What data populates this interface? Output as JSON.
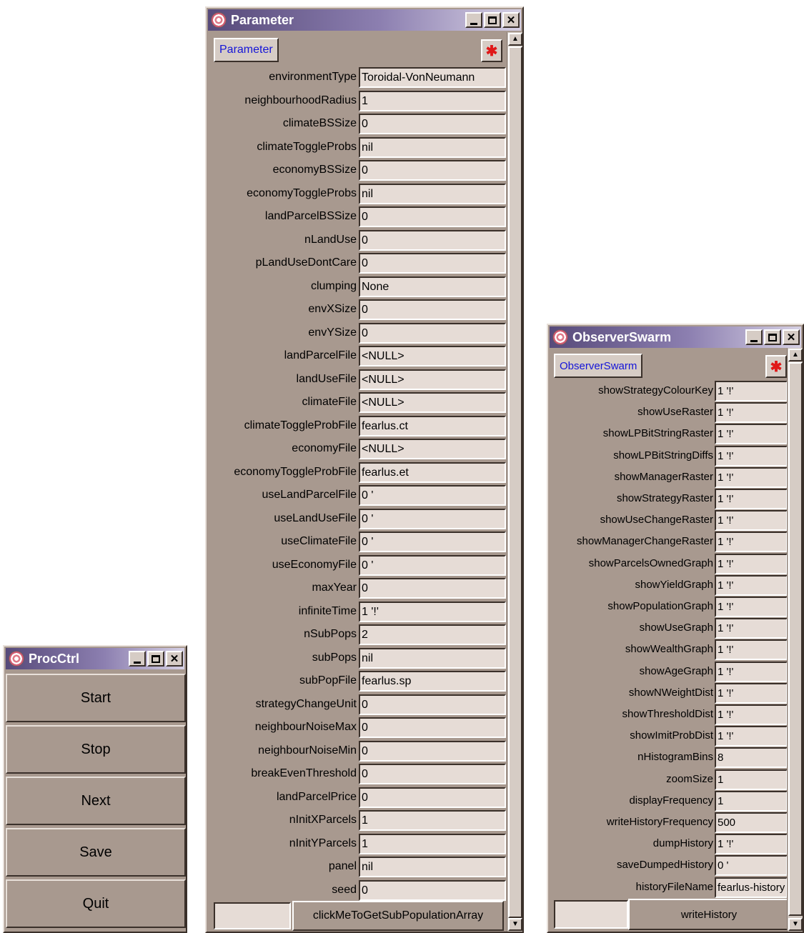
{
  "procctrl": {
    "title": "ProcCtrl",
    "buttons": [
      {
        "label": "Start"
      },
      {
        "label": "Stop"
      },
      {
        "label": "Next"
      },
      {
        "label": "Save"
      },
      {
        "label": "Quit"
      }
    ]
  },
  "parameter": {
    "title": "Parameter",
    "tag_label": "Parameter",
    "fields": [
      {
        "label": "environmentType",
        "value": "Toroidal-VonNeumann"
      },
      {
        "label": "neighbourhoodRadius",
        "value": "1"
      },
      {
        "label": "climateBSSize",
        "value": "0"
      },
      {
        "label": "climateToggleProbs",
        "value": "nil"
      },
      {
        "label": "economyBSSize",
        "value": "0"
      },
      {
        "label": "economyToggleProbs",
        "value": "nil"
      },
      {
        "label": "landParcelBSSize",
        "value": "0"
      },
      {
        "label": "nLandUse",
        "value": "0"
      },
      {
        "label": "pLandUseDontCare",
        "value": "0"
      },
      {
        "label": "clumping",
        "value": "None"
      },
      {
        "label": "envXSize",
        "value": "0"
      },
      {
        "label": "envYSize",
        "value": "0"
      },
      {
        "label": "landParcelFile",
        "value": "<NULL>"
      },
      {
        "label": "landUseFile",
        "value": "<NULL>"
      },
      {
        "label": "climateFile",
        "value": "<NULL>"
      },
      {
        "label": "climateToggleProbFile",
        "value": "fearlus.ct"
      },
      {
        "label": "economyFile",
        "value": "<NULL>"
      },
      {
        "label": "economyToggleProbFile",
        "value": "fearlus.et"
      },
      {
        "label": "useLandParcelFile",
        "value": "0 '"
      },
      {
        "label": "useLandUseFile",
        "value": "0 '"
      },
      {
        "label": "useClimateFile",
        "value": "0 '"
      },
      {
        "label": "useEconomyFile",
        "value": "0 '"
      },
      {
        "label": "maxYear",
        "value": "0"
      },
      {
        "label": "infiniteTime",
        "value": "1 '!'"
      },
      {
        "label": "nSubPops",
        "value": "2"
      },
      {
        "label": "subPops",
        "value": "nil"
      },
      {
        "label": "subPopFile",
        "value": "fearlus.sp"
      },
      {
        "label": "strategyChangeUnit",
        "value": "0"
      },
      {
        "label": "neighbourNoiseMax",
        "value": "0"
      },
      {
        "label": "neighbourNoiseMin",
        "value": "0"
      },
      {
        "label": "breakEvenThreshold",
        "value": "0"
      },
      {
        "label": "landParcelPrice",
        "value": "0"
      },
      {
        "label": "nInitXParcels",
        "value": "1"
      },
      {
        "label": "nInitYParcels",
        "value": "1"
      },
      {
        "label": "panel",
        "value": "nil"
      },
      {
        "label": "seed",
        "value": "0"
      }
    ],
    "action_label": "clickMeToGetSubPopulationArray"
  },
  "observer": {
    "title": "ObserverSwarm",
    "tag_label": "ObserverSwarm",
    "fields": [
      {
        "label": "showStrategyColourKey",
        "value": "1 '!'"
      },
      {
        "label": "showUseRaster",
        "value": "1 '!'"
      },
      {
        "label": "showLPBitStringRaster",
        "value": "1 '!'"
      },
      {
        "label": "showLPBitStringDiffs",
        "value": "1 '!'"
      },
      {
        "label": "showManagerRaster",
        "value": "1 '!'"
      },
      {
        "label": "showStrategyRaster",
        "value": "1 '!'"
      },
      {
        "label": "showUseChangeRaster",
        "value": "1 '!'"
      },
      {
        "label": "showManagerChangeRaster",
        "value": "1 '!'"
      },
      {
        "label": "showParcelsOwnedGraph",
        "value": "1 '!'"
      },
      {
        "label": "showYieldGraph",
        "value": "1 '!'"
      },
      {
        "label": "showPopulationGraph",
        "value": "1 '!'"
      },
      {
        "label": "showUseGraph",
        "value": "1 '!'"
      },
      {
        "label": "showWealthGraph",
        "value": "1 '!'"
      },
      {
        "label": "showAgeGraph",
        "value": "1 '!'"
      },
      {
        "label": "showNWeightDist",
        "value": "1 '!'"
      },
      {
        "label": "showThresholdDist",
        "value": "1 '!'"
      },
      {
        "label": "showImitProbDist",
        "value": "1 '!'"
      },
      {
        "label": "nHistogramBins",
        "value": "8"
      },
      {
        "label": "zoomSize",
        "value": "1"
      },
      {
        "label": "displayFrequency",
        "value": "1"
      },
      {
        "label": "writeHistoryFrequency",
        "value": "500"
      },
      {
        "label": "dumpHistory",
        "value": "1 '!'"
      },
      {
        "label": "saveDumpedHistory",
        "value": "0 '"
      },
      {
        "label": "historyFileName",
        "value": "fearlus-history"
      }
    ],
    "action_label": "writeHistory"
  },
  "icons": {
    "app": "swarm-app-icon",
    "minimize": "minimize-icon",
    "maximize": "maximize-icon",
    "close": "close-icon",
    "bug_close": "bug-close-icon"
  },
  "colors": {
    "window_bg": "#a8998f",
    "title_gradient_start": "#574a7a",
    "field_bg": "#e6dcd6",
    "tag_text": "#1414d8",
    "bug_icon": "#e01818"
  }
}
